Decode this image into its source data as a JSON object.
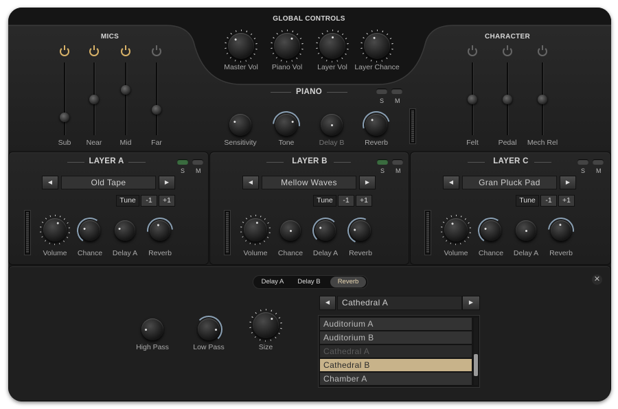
{
  "global": {
    "title": "GLOBAL CONTROLS",
    "knobs": [
      "Master Vol",
      "Piano Vol",
      "Layer Vol",
      "Layer Chance"
    ]
  },
  "mics": {
    "title": "MICS",
    "sliders": [
      {
        "label": "Sub",
        "level": 0.22,
        "power": true
      },
      {
        "label": "Near",
        "level": 0.48,
        "power": true
      },
      {
        "label": "Mid",
        "level": 0.62,
        "power": true
      },
      {
        "label": "Far",
        "level": 0.33,
        "power": false
      }
    ]
  },
  "character": {
    "title": "CHARACTER",
    "sliders": [
      {
        "label": "Felt",
        "level": 0.48,
        "power": false
      },
      {
        "label": "Pedal",
        "level": 0.48,
        "power": false
      },
      {
        "label": "Mech Rel",
        "level": 0.48,
        "power": false
      }
    ]
  },
  "piano": {
    "title": "PIANO",
    "s": "S",
    "m": "M",
    "knobs": [
      "Sensitivity",
      "Tone",
      "Delay B",
      "Reverb"
    ]
  },
  "layers": [
    {
      "title": "LAYER A",
      "preset": "Old Tape",
      "tune_label": "Tune",
      "tune_minus": "-1",
      "tune_plus": "+1",
      "s": "S",
      "m": "M",
      "knobs": [
        "Volume",
        "Chance",
        "Delay A",
        "Reverb"
      ]
    },
    {
      "title": "LAYER B",
      "preset": "Mellow Waves",
      "tune_label": "Tune",
      "tune_minus": "-1",
      "tune_plus": "+1",
      "s": "S",
      "m": "M",
      "knobs": [
        "Volume",
        "Chance",
        "Delay A",
        "Reverb"
      ]
    },
    {
      "title": "LAYER C",
      "preset": "Gran Pluck Pad",
      "tune_label": "Tune",
      "tune_minus": "-1",
      "tune_plus": "+1",
      "s": "S",
      "m": "M",
      "knobs": [
        "Volume",
        "Chance",
        "Delay A",
        "Reverb"
      ]
    }
  ],
  "effects": {
    "tabs": [
      "Delay A",
      "Delay B",
      "Reverb"
    ],
    "active_tab": "Reverb",
    "knobs": [
      "High Pass",
      "Low Pass",
      "Size"
    ],
    "preset": "Cathedral A",
    "list": [
      "Auditorium A",
      "Auditorium B",
      "Cathedral A",
      "Cathedral B",
      "Chamber A"
    ],
    "selected": "Cathedral B",
    "close_icon": "close-icon"
  },
  "colors": {
    "accent": "#c8b38a",
    "power_on": "#d8b268",
    "background": "#1b1b1b"
  }
}
